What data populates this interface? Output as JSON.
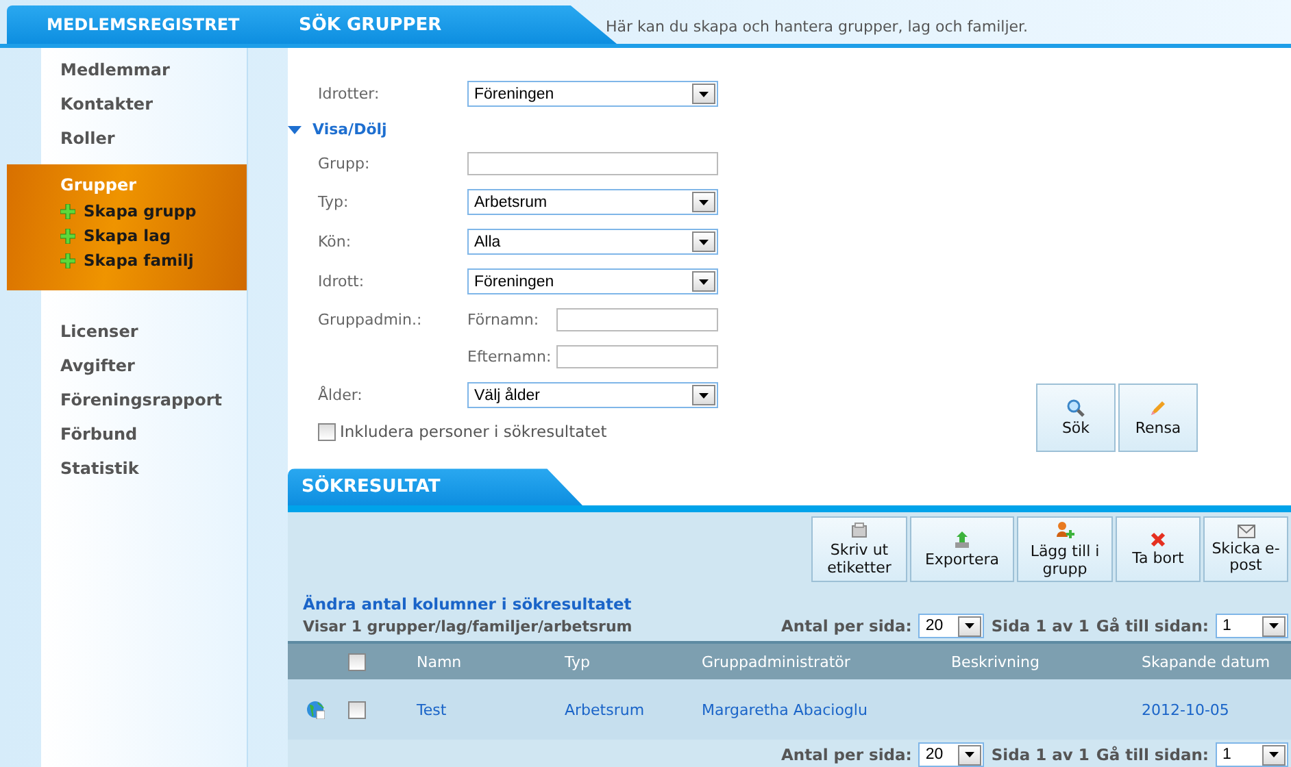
{
  "header": {
    "app_title": "MEDLEMSREGISTRET",
    "section_title": "SÖK GRUPPER",
    "description": "Här kan du skapa och hantera grupper, lag och familjer."
  },
  "sidebar": {
    "items": [
      {
        "label": "Medlemmar",
        "selected": false
      },
      {
        "label": "Kontakter",
        "selected": false
      },
      {
        "label": "Roller",
        "selected": false
      },
      {
        "label": "Grupper",
        "selected": true,
        "children": [
          {
            "label": "Skapa grupp"
          },
          {
            "label": "Skapa lag"
          },
          {
            "label": "Skapa familj"
          }
        ]
      },
      {
        "label": "Licenser",
        "selected": false
      },
      {
        "label": "Avgifter",
        "selected": false
      },
      {
        "label": "Föreningsrapport",
        "selected": false
      },
      {
        "label": "Förbund",
        "selected": false
      },
      {
        "label": "Statistik",
        "selected": false
      }
    ]
  },
  "filters": [
    {
      "kind": "select",
      "label": "Idrotter:",
      "value": "Föreningen"
    },
    {
      "kind": "toggle",
      "label": "Visa/Dölj",
      "expanded": true
    },
    {
      "kind": "text",
      "label": "Grupp:"
    },
    {
      "kind": "select",
      "label": "Typ:",
      "value": "Arbetsrum"
    },
    {
      "kind": "select",
      "label": "Kön:",
      "value": "Alla"
    },
    {
      "kind": "select",
      "label": "Idrott:",
      "value": "Föreningen"
    },
    {
      "kind": "name",
      "label": "Gruppadmin.:",
      "sublabel": "Förnamn:"
    },
    {
      "kind": "name",
      "sublabel": "Efternamn:"
    },
    {
      "kind": "select",
      "label": "Ålder:",
      "value": "Välj ålder"
    },
    {
      "kind": "checkbox",
      "label": "Inkludera personer i sökresultatet",
      "checked": false
    }
  ],
  "search_buttons": [
    "Sök",
    "Rensa"
  ],
  "results": {
    "title": "SÖKRESULTAT",
    "toolbar": [
      "Skriv ut etiketter",
      "Exportera",
      "Lägg till i grupp",
      "Ta bort",
      "Skicka e-post"
    ],
    "columns_link": "Ändra antal kolumner i sökresultatet",
    "count": "Visar 1 grupper/lag/familjer/arbetsrum",
    "pager": {
      "per_page_label": "Antal per sida:",
      "per_page": "20",
      "page_info": "Sida 1 av 1",
      "goto_label": "Gå till sidan:",
      "goto": "1"
    },
    "columns": [
      "Namn",
      "Typ",
      "Gruppadministratör",
      "Beskrivning",
      "Skapande datum"
    ],
    "select_all": false,
    "rows": [
      {
        "checked": false,
        "cells": [
          "Test",
          "Arbetsrum",
          "Margaretha Abacioglu",
          "",
          "2012-10-05"
        ]
      }
    ],
    "bottom_pager": {
      "per_page_label": "Antal per sida:",
      "per_page": "20",
      "page_info": "Sida 1 av 1",
      "goto_label": "Gå till sidan:",
      "goto": "1"
    }
  }
}
